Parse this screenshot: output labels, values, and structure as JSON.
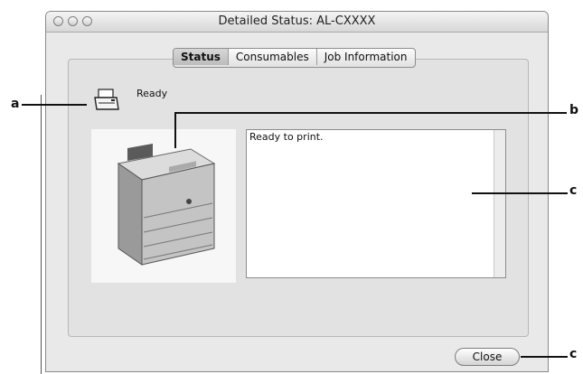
{
  "window": {
    "title": "Detailed Status: AL-CXXXX"
  },
  "tabs": [
    {
      "label": "Status",
      "active": true
    },
    {
      "label": "Consumables",
      "active": false
    },
    {
      "label": "Job Information",
      "active": false
    }
  ],
  "status": {
    "icon": "printer-icon",
    "text": "Ready"
  },
  "message": {
    "text": "Ready to print."
  },
  "buttons": {
    "close_label": "Close"
  },
  "callouts": {
    "a": "a",
    "b": "b",
    "c1": "c",
    "c2": "c"
  },
  "colors": {
    "window_bg": "#e9e9e9",
    "panel_bg": "#e2e2e2",
    "message_bg": "#ffffff"
  }
}
